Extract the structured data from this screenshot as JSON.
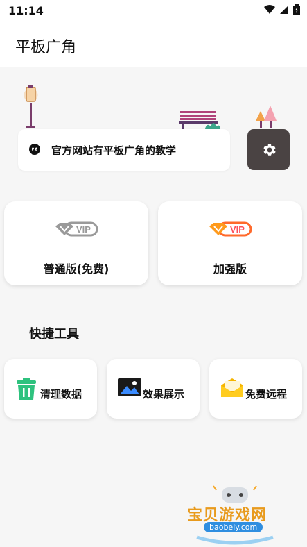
{
  "status_bar": {
    "time": "11:14"
  },
  "app_bar": {
    "title": "平板广角"
  },
  "notice": {
    "text": "官方网站有平板广角的教学"
  },
  "vip_cards": [
    {
      "label": "普通版(免费)",
      "badge": "VIP",
      "badge_color": "#9a9a9a"
    },
    {
      "label": "加强版",
      "badge": "VIP",
      "badge_color": "#ff6a2c"
    }
  ],
  "tools": {
    "title": "快捷工具",
    "items": [
      {
        "label": "清理数据",
        "icon": "trash-icon",
        "color": "#2ec27e"
      },
      {
        "label": "效果展示",
        "icon": "image-icon",
        "color": "#1a1a1a"
      },
      {
        "label": "免费远程",
        "icon": "envelope-icon",
        "color": "#f5b400"
      }
    ]
  },
  "watermark": {
    "text": "宝贝游戏网",
    "domain": "baobeiy.com"
  },
  "colors": {
    "settings_bg": "#4a4343",
    "background": "#f6f6f6"
  }
}
